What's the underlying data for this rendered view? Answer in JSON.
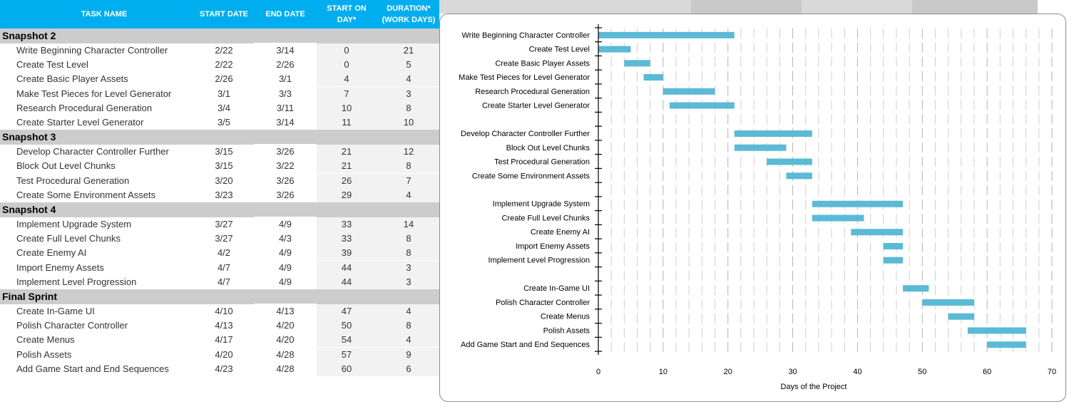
{
  "table": {
    "headers": {
      "task_name": "TASK NAME",
      "start_date": "START DATE",
      "end_date": "END DATE",
      "start_on_day": [
        "START ON",
        "DAY*"
      ],
      "duration": [
        "DURATION*",
        "(WORK DAYS)"
      ]
    },
    "groups": [
      {
        "name": "Snapshot 2",
        "tasks": [
          {
            "name": "Write Beginning Character Controller",
            "start": "2/22",
            "end": "3/14",
            "start_day": "0",
            "duration": "21"
          },
          {
            "name": "Create Test Level",
            "start": "2/22",
            "end": "2/26",
            "start_day": "0",
            "duration": "5"
          },
          {
            "name": "Create Basic Player Assets",
            "start": "2/26",
            "end": "3/1",
            "start_day": "4",
            "duration": "4"
          },
          {
            "name": "Make Test Pieces for Level Generator",
            "start": "3/1",
            "end": "3/3",
            "start_day": "7",
            "duration": "3"
          },
          {
            "name": "Research Procedural Generation",
            "start": "3/4",
            "end": "3/11",
            "start_day": "10",
            "duration": "8"
          },
          {
            "name": "Create Starter Level Generator",
            "start": "3/5",
            "end": "3/14",
            "start_day": "11",
            "duration": "10"
          }
        ]
      },
      {
        "name": "Snapshot 3",
        "tasks": [
          {
            "name": "Develop Character Controller Further",
            "start": "3/15",
            "end": "3/26",
            "start_day": "21",
            "duration": "12"
          },
          {
            "name": "Block Out Level Chunks",
            "start": "3/15",
            "end": "3/22",
            "start_day": "21",
            "duration": "8"
          },
          {
            "name": "Test Procedural Generation",
            "start": "3/20",
            "end": "3/26",
            "start_day": "26",
            "duration": "7"
          },
          {
            "name": "Create Some Environment Assets",
            "start": "3/23",
            "end": "3/26",
            "start_day": "29",
            "duration": "4"
          }
        ]
      },
      {
        "name": "Snapshot 4",
        "tasks": [
          {
            "name": "Implement Upgrade System",
            "start": "3/27",
            "end": "4/9",
            "start_day": "33",
            "duration": "14"
          },
          {
            "name": "Create Full Level Chunks",
            "start": "3/27",
            "end": "4/3",
            "start_day": "33",
            "duration": "8"
          },
          {
            "name": "Create Enemy AI",
            "start": "4/2",
            "end": "4/9",
            "start_day": "39",
            "duration": "8"
          },
          {
            "name": "Import Enemy Assets",
            "start": "4/7",
            "end": "4/9",
            "start_day": "44",
            "duration": "3"
          },
          {
            "name": "Implement Level Progression",
            "start": "4/7",
            "end": "4/9",
            "start_day": "44",
            "duration": "3"
          }
        ]
      },
      {
        "name": "Final Sprint",
        "tasks": [
          {
            "name": "Create In-Game UI",
            "start": "4/10",
            "end": "4/13",
            "start_day": "47",
            "duration": "4"
          },
          {
            "name": "Polish Character Controller",
            "start": "4/13",
            "end": "4/20",
            "start_day": "50",
            "duration": "8"
          },
          {
            "name": "Create Menus",
            "start": "4/17",
            "end": "4/20",
            "start_day": "54",
            "duration": "4"
          },
          {
            "name": "Polish Assets",
            "start": "4/20",
            "end": "4/28",
            "start_day": "57",
            "duration": "9"
          },
          {
            "name": "Add Game Start and End Sequences",
            "start": "4/23",
            "end": "4/28",
            "start_day": "60",
            "duration": "6"
          }
        ]
      }
    ]
  },
  "colors": {
    "header_bg": "#00aeef",
    "group_bg": "#cccccc",
    "bar": "#5bbad5",
    "shade": "#f2f2f2"
  },
  "chart_data": {
    "type": "bar",
    "orientation": "horizontal-stacked-gantt",
    "title": "",
    "xlabel": "Days of the Project",
    "ylabel": "",
    "xlim": [
      0,
      70
    ],
    "x_ticks": [
      "0",
      "10",
      "20",
      "30",
      "40",
      "50",
      "60",
      "70"
    ],
    "grid": "vertical minor gridlines every 2 days",
    "legend": "none",
    "categories": [
      "Write Beginning Character Controller",
      "Create Test Level",
      "Create Basic Player Assets",
      "Make Test Pieces for Level Generator",
      "Research Procedural Generation",
      "Create Starter Level Generator",
      "",
      "Develop Character Controller Further",
      "Block Out Level Chunks",
      "Test Procedural Generation",
      "Create Some Environment Assets",
      "",
      "Implement Upgrade System",
      "Create Full Level Chunks",
      "Create Enemy AI",
      "Import Enemy Assets",
      "Implement Level Progression",
      "",
      "Create In-Game UI",
      "Polish Character Controller",
      "Create Menus",
      "Polish Assets",
      "Add Game Start and End Sequences"
    ],
    "series": [
      {
        "name": "Start on Day",
        "visible": false,
        "values": [
          0,
          0,
          4,
          7,
          10,
          11,
          null,
          21,
          21,
          26,
          29,
          null,
          33,
          33,
          39,
          44,
          44,
          null,
          47,
          50,
          54,
          57,
          60
        ]
      },
      {
        "name": "Duration",
        "visible": true,
        "values": [
          21,
          5,
          4,
          3,
          8,
          10,
          null,
          12,
          8,
          7,
          4,
          null,
          14,
          8,
          8,
          3,
          3,
          null,
          4,
          8,
          4,
          9,
          6
        ]
      }
    ]
  }
}
